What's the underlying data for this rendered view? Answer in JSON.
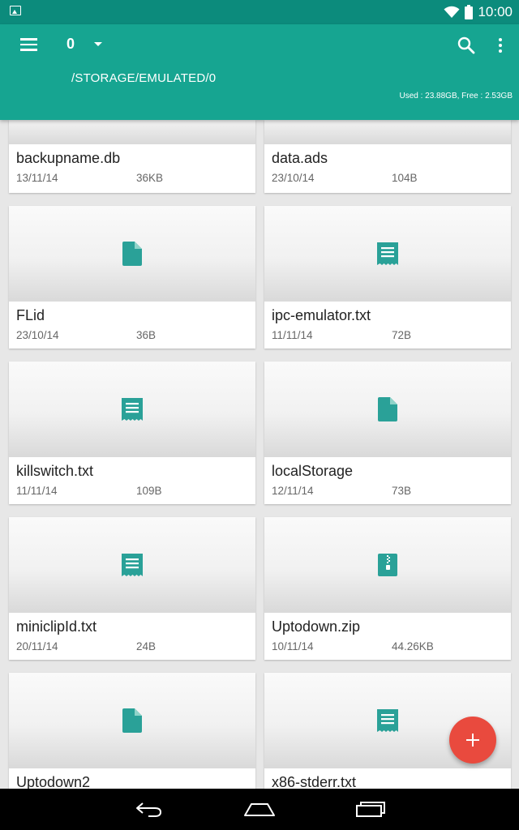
{
  "status_bar": {
    "time": "10:00"
  },
  "app_bar": {
    "drive_value": "0",
    "path": "/STORAGE/EMULATED/0",
    "storage_info": "Used : 23.88GB, Free : 2.53GB"
  },
  "colors": {
    "status_bar": "#0c8b7c",
    "app_bar": "#16a591",
    "accent": "#2aa198",
    "fab": "#e94a3e"
  },
  "files": [
    {
      "name": "backupname.db",
      "date": "13/11/14",
      "size": "36KB",
      "icon": "file-icon"
    },
    {
      "name": "data.ads",
      "date": "23/10/14",
      "size": "104B",
      "icon": "file-icon"
    },
    {
      "name": "FLid",
      "date": "23/10/14",
      "size": "36B",
      "icon": "file-icon"
    },
    {
      "name": "ipc-emulator.txt",
      "date": "11/11/14",
      "size": "72B",
      "icon": "text-file-icon"
    },
    {
      "name": "killswitch.txt",
      "date": "11/11/14",
      "size": "109B",
      "icon": "text-file-icon"
    },
    {
      "name": "localStorage",
      "date": "12/11/14",
      "size": "73B",
      "icon": "file-icon"
    },
    {
      "name": "miniclipId.txt",
      "date": "20/11/14",
      "size": "24B",
      "icon": "text-file-icon"
    },
    {
      "name": "Uptodown.zip",
      "date": "10/11/14",
      "size": "44.26KB",
      "icon": "zip-file-icon"
    },
    {
      "name": "Uptodown2",
      "icon": "file-icon"
    },
    {
      "name": "x86-stderr.txt",
      "icon": "text-file-icon"
    }
  ]
}
